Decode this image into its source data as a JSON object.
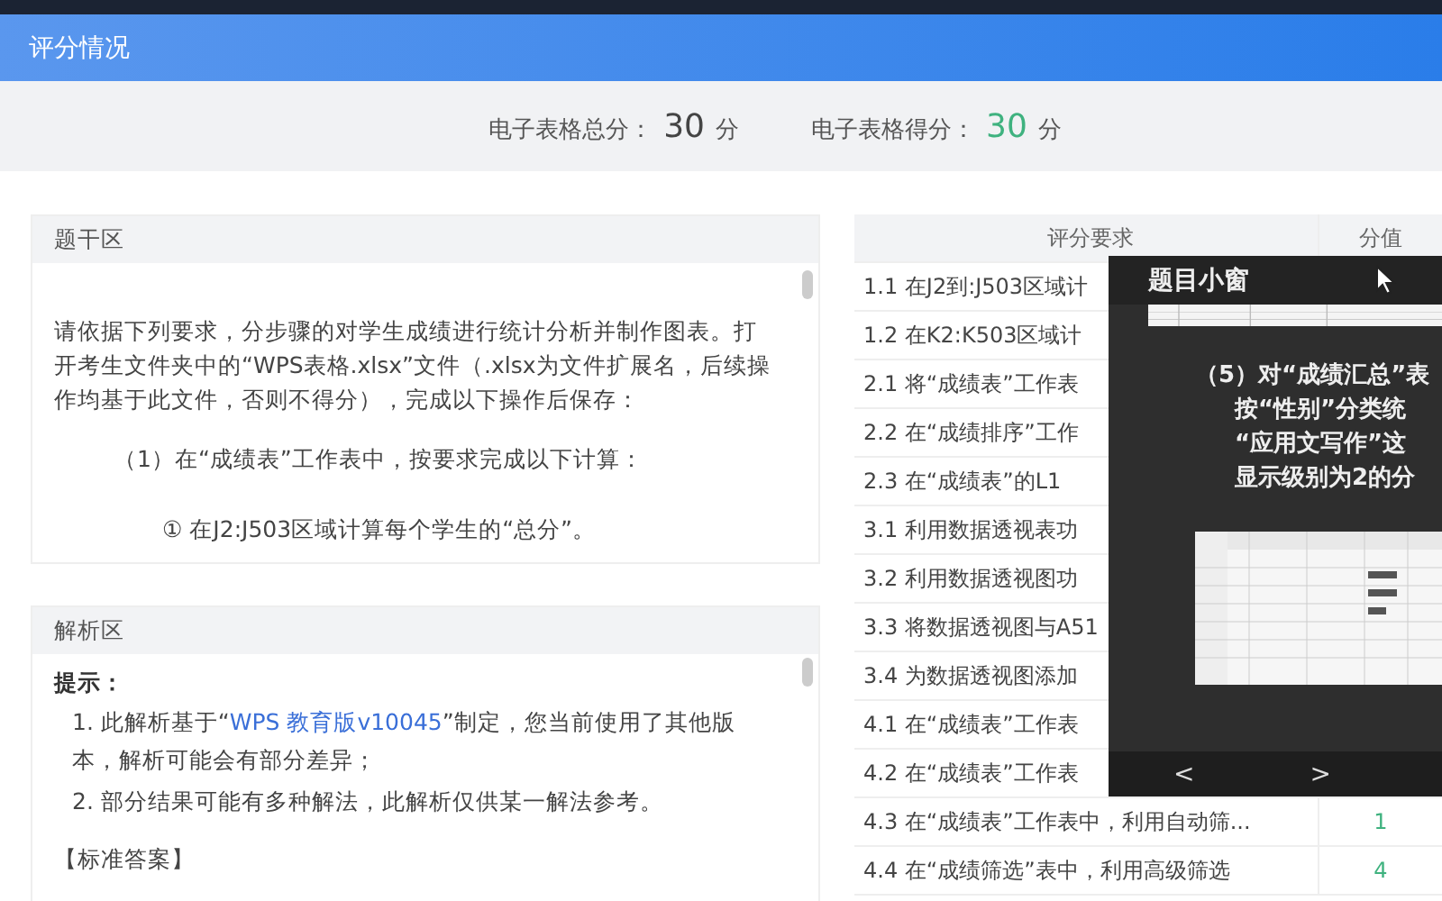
{
  "header": {
    "title": "评分情况"
  },
  "summary": [
    {
      "label": "电子表格总分：",
      "value": "30",
      "unit": "分",
      "kind": "total"
    },
    {
      "label": "电子表格得分：",
      "value": "30",
      "unit": "分",
      "kind": "earned"
    }
  ],
  "stem": {
    "title": "题干区",
    "paragraphs": [
      {
        "text": "请依据下列要求，分步骤的对学生成绩进行统计分析并制作图表。打开考生文件夹中的“WPS表格.xlsx”文件（.xlsx为文件扩展名，后续操作均基于此文件，否则不得分），完成以下操作后保存：",
        "kind": "para"
      },
      {
        "text": "（1）在“成绩表”工作表中，按要求完成以下计算：",
        "kind": "step"
      },
      {
        "text": "① 在J2:J503区域计算每个学生的“总分”。",
        "kind": "substep"
      }
    ]
  },
  "analysis": {
    "title": "解析区",
    "hint_title": "提示：",
    "notes": [
      {
        "before": "1. 此解析基于“",
        "link": "WPS 教育版v10045",
        "after": "”制定，您当前使用了其他版本，解析可能会有部分差异；"
      },
      {
        "before": "2. 部分结果可能有多种解法，此解析仅供某一解法参考。"
      }
    ],
    "answer_title": "【标准答案】"
  },
  "table": {
    "columns": [
      "评分要求",
      "分值"
    ],
    "rows": [
      {
        "text": "1.1 在J2到:J503区域计"
      },
      {
        "text": "1.2 在K2:K503区域计"
      },
      {
        "text": "2.1 将“成绩表”工作表"
      },
      {
        "text": "2.2 在“成绩排序”工作"
      },
      {
        "text": "2.3 在“成绩表”的L1"
      },
      {
        "text": "3.1 利用数据透视表功"
      },
      {
        "text": "3.2 利用数据透视图功"
      },
      {
        "text": "3.3 将数据透视图与A51"
      },
      {
        "text": "3.4 为数据透视图添加"
      },
      {
        "text": "4.1 在“成绩表”工作表"
      },
      {
        "text": "4.2 在“成绩表”工作表"
      },
      {
        "text": "4.3 在“成绩表”工作表中，利用自动筛...",
        "score": "1"
      },
      {
        "text": "4.4 在“成绩筛选”表中，利用高级筛选",
        "score": "4"
      }
    ]
  },
  "popup": {
    "title": "题目小窗",
    "lines": [
      "（5）对“成绩汇总”表",
      "按“性别”分类统",
      "“应用文写作”这",
      "显示级别为2的分"
    ],
    "nav": [
      "<",
      ">"
    ]
  }
}
